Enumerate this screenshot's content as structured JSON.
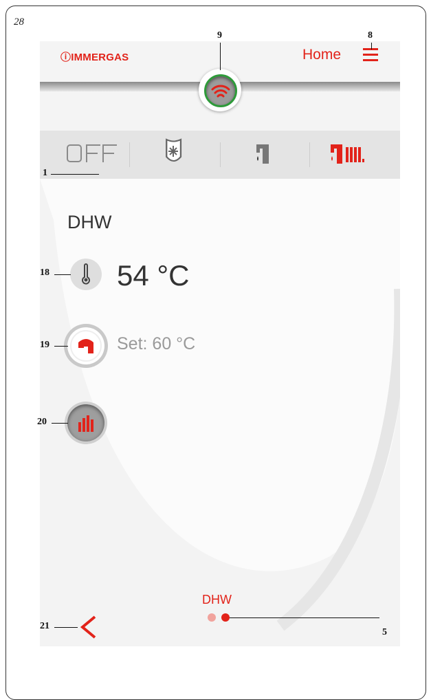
{
  "page": {
    "number": "28"
  },
  "callouts": {
    "c1": "1",
    "c5": "5",
    "c8": "8",
    "c9": "9",
    "c18": "18",
    "c19": "19",
    "c20": "20",
    "c21": "21"
  },
  "header": {
    "logo": "ⓘIMMERGAS",
    "title": "Home",
    "menu_icon": "hamburger-menu-icon",
    "connection_icon": "wifi-icon"
  },
  "modes": [
    {
      "label": "OFF",
      "icon": "off-icon",
      "active": false
    },
    {
      "label": "",
      "icon": "antifreeze-icon",
      "active": false
    },
    {
      "label": "",
      "icon": "dhw-tap-icon",
      "active": false
    },
    {
      "label": "",
      "icon": "dhw-and-heating-icon",
      "active": true
    }
  ],
  "main": {
    "section_title": "DHW",
    "current_temperature": "54 °C",
    "setpoint": "Set: 60 °C",
    "temperature_icon": "thermometer-icon",
    "setpoint_icon": "tap-icon",
    "extra_icon": "heating-flame-icon"
  },
  "footer": {
    "page_label": "DHW",
    "back_icon": "chevron-left-icon",
    "pager": {
      "total": 2,
      "current": 2
    }
  },
  "colors": {
    "accent": "#e2231a",
    "connected": "#2e9a3a",
    "text_dark": "#333333",
    "text_muted": "#9a9a9a"
  }
}
